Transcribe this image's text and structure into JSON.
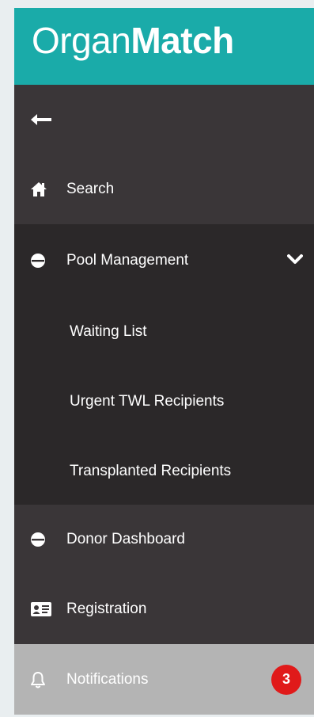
{
  "brand": {
    "light": "Organ",
    "bold": "Match"
  },
  "nav": {
    "back": {
      "icon": "back-arrow-icon"
    },
    "search": {
      "label": "Search",
      "icon": "home-icon"
    },
    "pool_management": {
      "label": "Pool Management",
      "icon": "half-circle-icon",
      "expanded": true,
      "subitems": [
        {
          "label": "Waiting List"
        },
        {
          "label": "Urgent TWL Recipients"
        },
        {
          "label": "Transplanted Recipients"
        }
      ]
    },
    "donor_dashboard": {
      "label": "Donor Dashboard",
      "icon": "half-circle-icon"
    },
    "registration": {
      "label": "Registration",
      "icon": "id-card-icon"
    },
    "notifications": {
      "label": "Notifications",
      "icon": "bell-icon",
      "badge": "3"
    }
  },
  "colors": {
    "brand": "#1aaba9",
    "sidebar": "#3a3638",
    "submenu": "#2b2829",
    "active": "#b4b4b4",
    "badge": "#e01a1a"
  }
}
